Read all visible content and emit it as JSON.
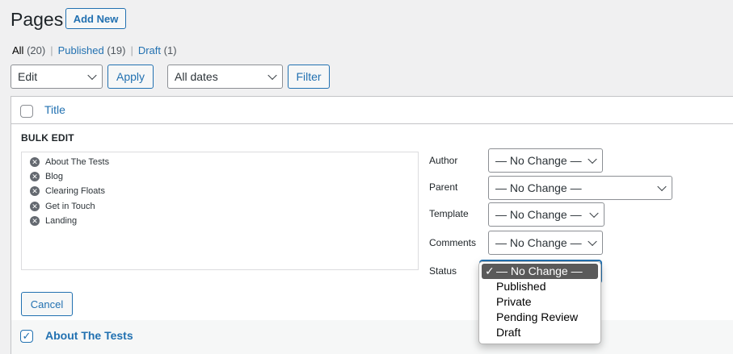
{
  "header": {
    "title": "Pages",
    "add_new_label": "Add New"
  },
  "views": [
    {
      "label": "All",
      "count": "(20)"
    },
    {
      "label": "Published",
      "count": "(19)"
    },
    {
      "label": "Draft",
      "count": "(1)"
    }
  ],
  "toolbar": {
    "bulk_action_value": "Edit",
    "apply_label": "Apply",
    "dates_value": "All dates",
    "filter_label": "Filter"
  },
  "table": {
    "title_column": "Title"
  },
  "bulk_edit": {
    "heading": "BULK EDIT",
    "titles": [
      "About The Tests",
      "Blog",
      "Clearing Floats",
      "Get in Touch",
      "Landing"
    ],
    "remove_icon_glyph": "✕",
    "fields": {
      "author": {
        "label": "Author",
        "value": "— No Change —"
      },
      "parent": {
        "label": "Parent",
        "value": "— No Change —"
      },
      "template": {
        "label": "Template",
        "value": "— No Change —"
      },
      "comments": {
        "label": "Comments",
        "value": "— No Change —"
      },
      "status": {
        "label": "Status"
      }
    },
    "cancel_label": "Cancel",
    "status_options": [
      {
        "label": "— No Change —",
        "selected": true
      },
      {
        "label": "Published",
        "selected": false
      },
      {
        "label": "Private",
        "selected": false
      },
      {
        "label": "Pending Review",
        "selected": false
      },
      {
        "label": "Draft",
        "selected": false
      }
    ],
    "check_glyph": "✓"
  },
  "rows": [
    {
      "title": "About The Tests",
      "checked": true,
      "check_glyph": "✓"
    }
  ],
  "colors": {
    "accent": "#2271b1",
    "background": "#f0f0f1",
    "dropdown_selected": "#5a5a5a"
  }
}
